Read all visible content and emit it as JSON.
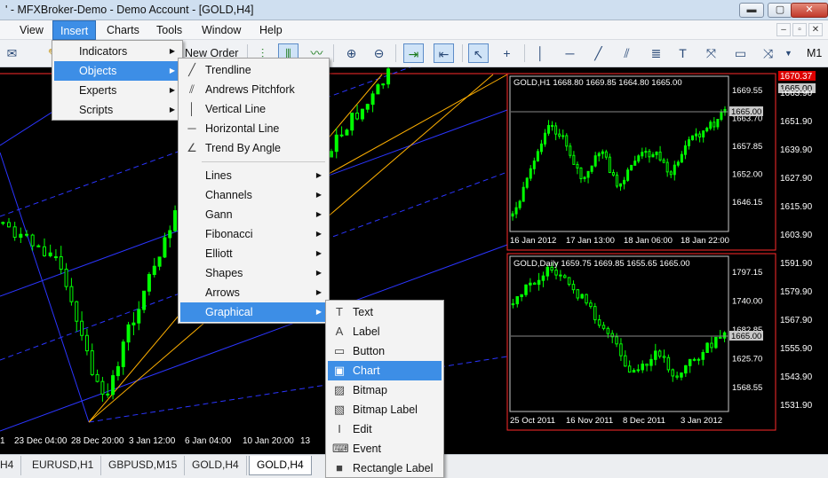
{
  "window": {
    "title": "' - MFXBroker-Demo - Demo Account - [GOLD,H4]",
    "btn_minimize": "▬",
    "btn_restore": "▢",
    "btn_close": "✕"
  },
  "menubar": {
    "items": [
      "View",
      "Insert",
      "Charts",
      "Tools",
      "Window",
      "Help"
    ],
    "mdi": [
      "–",
      "▫",
      "✕"
    ]
  },
  "toolbar": {
    "new_order": "New Order",
    "timeframe": "M1"
  },
  "insert_menu": {
    "items": [
      {
        "label": "Indicators",
        "submenu": true
      },
      {
        "label": "Objects",
        "submenu": true
      },
      {
        "label": "Experts",
        "submenu": true
      },
      {
        "label": "Scripts",
        "submenu": true
      }
    ]
  },
  "objects_menu": {
    "items": [
      {
        "label": "Trendline",
        "icon": "trendline-icon"
      },
      {
        "label": "Andrews Pitchfork",
        "icon": "pitchfork-icon"
      },
      {
        "label": "Vertical Line",
        "icon": "vertical-line-icon"
      },
      {
        "label": "Horizontal Line",
        "icon": "horizontal-line-icon"
      },
      {
        "label": "Trend By Angle",
        "icon": "angle-icon"
      }
    ],
    "submenus": [
      "Lines",
      "Channels",
      "Gann",
      "Fibonacci",
      "Elliott",
      "Shapes",
      "Arrows",
      "Graphical"
    ]
  },
  "graphical_menu": {
    "items": [
      {
        "label": "Text",
        "icon": "text-icon"
      },
      {
        "label": "Label",
        "icon": "label-icon"
      },
      {
        "label": "Button",
        "icon": "button-icon"
      },
      {
        "label": "Chart",
        "icon": "chart-icon"
      },
      {
        "label": "Bitmap",
        "icon": "bitmap-icon"
      },
      {
        "label": "Bitmap Label",
        "icon": "bitmap-label-icon"
      },
      {
        "label": "Edit",
        "icon": "edit-icon"
      },
      {
        "label": "Event",
        "icon": "event-icon"
      },
      {
        "label": "Rectangle Label",
        "icon": "rectangle-label-icon"
      }
    ]
  },
  "main_chart": {
    "x_labels": [
      "1",
      "23 Dec 04:00",
      "28 Dec 20:00",
      "3 Jan 12:00",
      "6 Jan 04:00",
      "10 Jan 20:00",
      "13"
    ],
    "price_axis": [
      "1591.90",
      "1579.90",
      "1567.90",
      "1555.90",
      "1543.90",
      "1531.90"
    ]
  },
  "price_scale": {
    "current_price_red": "1670.37",
    "current_price_box": "1665.00",
    "labels": [
      "1663.90",
      "1651.90",
      "1639.90",
      "1627.90",
      "1615.90",
      "1603.90"
    ]
  },
  "mini_chart_h1": {
    "header": "GOLD,H1  1668.80 1669.85 1664.80 1665.00",
    "price_labels": [
      "1669.55",
      "1663.70",
      "1657.85",
      "1652.00",
      "1646.15"
    ],
    "current_price": "1665.00",
    "x_labels": [
      "16 Jan 2012",
      "17 Jan 13:00",
      "18 Jan 06:00",
      "18 Jan 22:00"
    ]
  },
  "mini_chart_daily": {
    "header": "GOLD,Daily  1659.75 1669.85 1655.65 1665.00",
    "price_labels": [
      "1797.15",
      "1740.00",
      "1682.85",
      "1625.70",
      "1568.55"
    ],
    "current_price": "1665.00",
    "x_labels": [
      "25 Oct 2011",
      "16 Nov 2011",
      "8 Dec 2011",
      "3 Jan 2012"
    ]
  },
  "tabs": {
    "items": [
      "H4",
      "EURUSD,H1",
      "GBPUSD,M15",
      "GOLD,H4",
      "GOLD,H4"
    ],
    "active_index": 4
  },
  "colors": {
    "candle": "#00ff00",
    "menu_highlight": "#3d8ee6",
    "chart_bg": "#000000",
    "object_border": "#ff0000"
  }
}
